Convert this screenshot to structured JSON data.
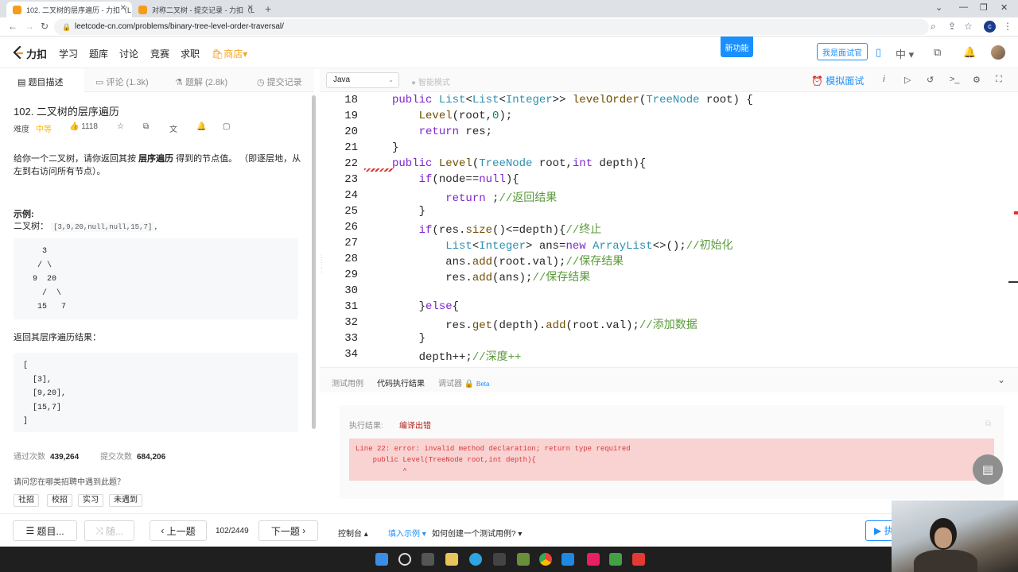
{
  "browser": {
    "tabs": [
      {
        "title": "102. 二叉树的层序遍历 - 力扣（L",
        "active": true
      },
      {
        "title": "对称二叉树 - 提交记录 - 力扣（L",
        "active": false
      }
    ],
    "url": "leetcode-cn.com/problems/binary-tree-level-order-traversal/",
    "profile_letter": "c"
  },
  "header": {
    "logo_text": "力扣",
    "nav": [
      "学习",
      "题库",
      "讨论",
      "竞赛",
      "求职"
    ],
    "shop": "商店",
    "new_feature": "新功能",
    "interviewer": "我是面试官",
    "lang": "中"
  },
  "left_tabs": [
    {
      "label": "题目描述",
      "icon": "file-icon"
    },
    {
      "label": "评论 (1.3k)",
      "icon": "comment-icon"
    },
    {
      "label": "题解 (2.8k)",
      "icon": "flask-icon"
    },
    {
      "label": "提交记录",
      "icon": "clock-icon"
    }
  ],
  "problem": {
    "title": "102. 二叉树的层序遍历",
    "difficulty_label": "难度",
    "difficulty": "中等",
    "likes": "1118",
    "description_pre": "给你一个二叉树，请你返回其按 ",
    "description_bold": "层序遍历",
    "description_post": " 得到的节点值。 （即逐层地，从左到右访问所有节点）。",
    "example_label": "示例:",
    "example_tree_label": "二叉树：",
    "example_tree_value": "[3,9,20,null,null,15,7]",
    "example_tree_suffix": ",",
    "tree_ascii": "    3\n   / \\\n  9  20\n    /  \\\n   15   7",
    "return_label": "返回其层序遍历结果：",
    "result_ascii": "[\n  [3],\n  [9,20],\n  [15,7]\n]",
    "accepted_label": "通过次数",
    "accepted": "439,264",
    "submitted_label": "提交次数",
    "submitted": "684,206",
    "question": "请问您在哪类招聘中遇到此题？",
    "chips": [
      "社招",
      "校招",
      "实习",
      "未遇到"
    ]
  },
  "editor": {
    "language": "Java",
    "smart_mode": "智能模式",
    "mock_interview": "模拟面试",
    "lines": [
      {
        "n": "18",
        "code": "public List<List<Integer>> levelOrder(TreeNode root) {"
      },
      {
        "n": "19",
        "code": "    Level(root,0);"
      },
      {
        "n": "20",
        "code": "    return res;"
      },
      {
        "n": "21",
        "code": "}"
      },
      {
        "n": "22",
        "code": "public Level(TreeNode root,int depth){"
      },
      {
        "n": "23",
        "code": "    if(node==null){"
      },
      {
        "n": "24",
        "code": "        return ;//返回结果"
      },
      {
        "n": "25",
        "code": "    }"
      },
      {
        "n": "26",
        "code": "    if(res.size()<=depth){//终止"
      },
      {
        "n": "27",
        "code": "        List<Integer> ans=new ArrayList<>();//初始化"
      },
      {
        "n": "28",
        "code": "        ans.add(root.val);//保存结果"
      },
      {
        "n": "29",
        "code": "        res.add(ans);//保存结果"
      },
      {
        "n": "30",
        "code": ""
      },
      {
        "n": "31",
        "code": "    }else{"
      },
      {
        "n": "32",
        "code": "        res.get(depth).add(root.val);//添加数据"
      },
      {
        "n": "33",
        "code": "    }"
      },
      {
        "n": "34",
        "code": "    depth++;//深度++"
      }
    ]
  },
  "result_tabs": [
    "测试用例",
    "代码执行结果",
    "调试器"
  ],
  "result_beta": "Beta",
  "result": {
    "exec_label": "执行结果:",
    "exec_value": "编译出错",
    "error_text": "Line 22: error: invalid method declaration; return type required\n    public Level(TreeNode root,int depth){\n           ^"
  },
  "footer": {
    "list_button": "题目...",
    "random_button": "随...",
    "prev_button": "上一题",
    "page": "102/2449",
    "next_button": "下一题",
    "console": "控制台",
    "fill_example": "填入示例",
    "how_to": "如何创建一个测试用例?",
    "run_label": "执"
  }
}
